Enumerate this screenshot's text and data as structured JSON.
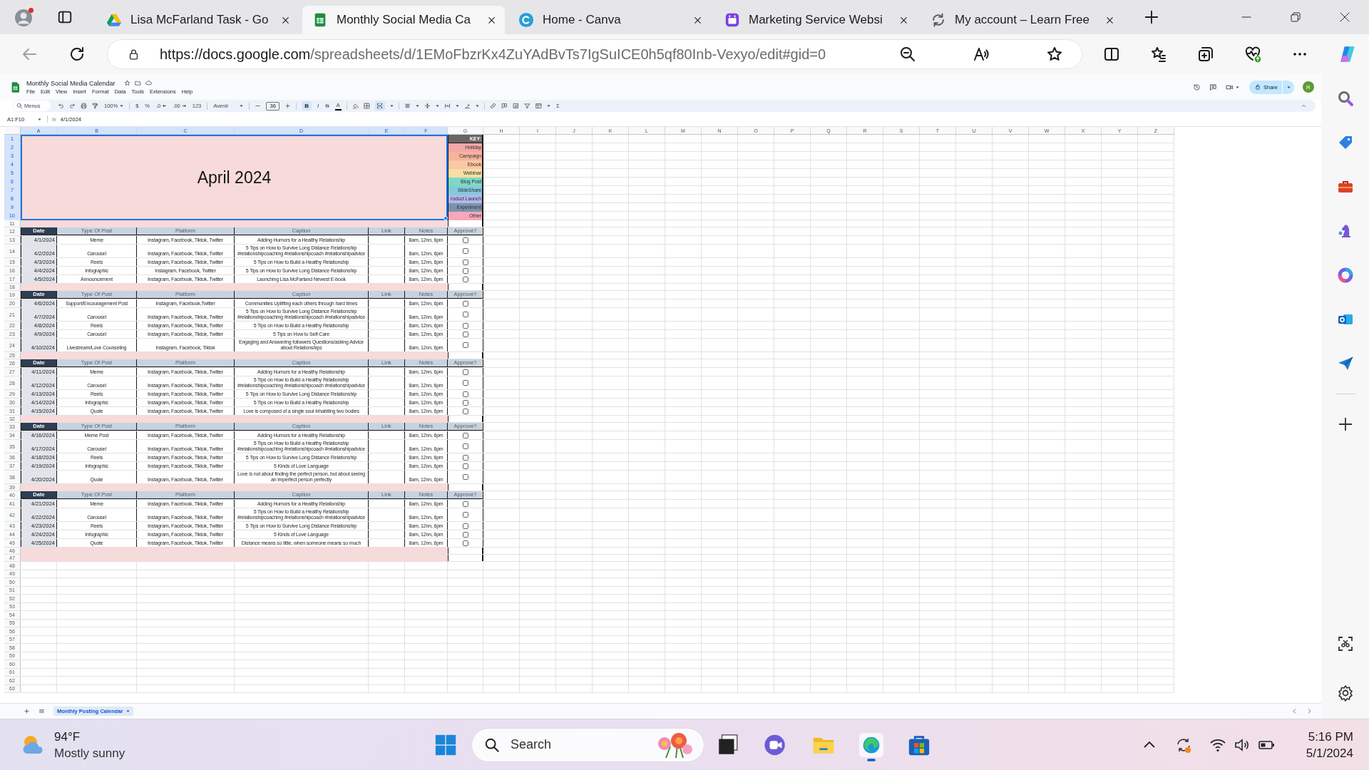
{
  "browser": {
    "tabs": [
      {
        "title": "Lisa McFarland Task - Go",
        "kind": "drive",
        "selected": false
      },
      {
        "title": "Monthly Social Media Ca",
        "kind": "sheets",
        "selected": true
      },
      {
        "title": "Home - Canva",
        "kind": "canva",
        "selected": false
      },
      {
        "title": "Marketing Service Websi",
        "kind": "calendar",
        "selected": false
      },
      {
        "title": "My account – Learn Free",
        "kind": "loading",
        "selected": false
      }
    ],
    "url": {
      "origin": "https://docs.google.com",
      "path": "/spreadsheets/d/1EMoFbzrKx4ZuYAdBvTs7IgSuICE0h5qf80Inb-Vexyo/edit#gid=0"
    }
  },
  "sheets_app": {
    "doc_title": "Monthly Social Media Calendar",
    "menu": [
      "File",
      "Edit",
      "View",
      "Insert",
      "Format",
      "Data",
      "Tools",
      "Extensions",
      "Help"
    ],
    "toolbar": {
      "menus_search": {
        "placeholder": "Menus"
      },
      "zoom": "100%",
      "currency": "$",
      "percent": "%",
      "decimal_decrease": ".0",
      "decimal_increase": ".00",
      "number_format": "123",
      "font": "Avenir",
      "font_size": "36",
      "bold": {
        "label": "B",
        "on": true
      },
      "italic": {
        "label": "I",
        "on": false
      },
      "strikethrough": {
        "label": "S",
        "on": false
      },
      "text_color": "A",
      "merge_on": true,
      "functions": "Σ"
    },
    "share": "Share",
    "account_initial": "R",
    "name_box": "A1:F10",
    "formula_label": "fx",
    "formula": "4/1/2024"
  },
  "sheet": {
    "columns": [
      {
        "label": "A",
        "selected": true
      },
      {
        "label": "B",
        "selected": true
      },
      {
        "label": "C",
        "selected": true
      },
      {
        "label": "D",
        "selected": true
      },
      {
        "label": "E",
        "selected": true
      },
      {
        "label": "F",
        "selected": true
      },
      {
        "label": "G",
        "selected": false
      },
      {
        "label": "H",
        "selected": false
      },
      {
        "label": "I",
        "selected": false
      },
      {
        "label": "J",
        "selected": false
      },
      {
        "label": "K",
        "selected": false
      },
      {
        "label": "L",
        "selected": false
      },
      {
        "label": "M",
        "selected": false
      },
      {
        "label": "N",
        "selected": false
      },
      {
        "label": "O",
        "selected": false
      },
      {
        "label": "P",
        "selected": false
      },
      {
        "label": "Q",
        "selected": false
      },
      {
        "label": "R",
        "selected": false
      },
      {
        "label": "S",
        "selected": false
      },
      {
        "label": "T",
        "selected": false
      },
      {
        "label": "U",
        "selected": false
      },
      {
        "label": "V",
        "selected": false
      },
      {
        "label": "W",
        "selected": false
      },
      {
        "label": "X",
        "selected": false
      },
      {
        "label": "Y",
        "selected": false
      },
      {
        "label": "Z",
        "selected": false
      }
    ],
    "row_numbers": [
      {
        "label": "1",
        "selected": true
      },
      {
        "label": "2",
        "selected": true
      },
      {
        "label": "3",
        "selected": true
      },
      {
        "label": "4",
        "selected": true
      },
      {
        "label": "5",
        "selected": true
      },
      {
        "label": "6",
        "selected": true
      },
      {
        "label": "7",
        "selected": true
      },
      {
        "label": "8",
        "selected": true
      },
      {
        "label": "9",
        "selected": true
      },
      {
        "label": "10",
        "selected": true
      },
      {
        "label": "11",
        "selected": false
      },
      {
        "label": "12",
        "selected": false
      },
      {
        "label": "13",
        "selected": false
      },
      {
        "label": "14",
        "selected": false
      },
      {
        "label": "15",
        "selected": false
      },
      {
        "label": "16",
        "selected": false
      },
      {
        "label": "17",
        "selected": false
      },
      {
        "label": "18",
        "selected": false
      },
      {
        "label": "19",
        "selected": false
      },
      {
        "label": "20",
        "selected": false
      },
      {
        "label": "21",
        "selected": false
      },
      {
        "label": "22",
        "selected": false
      },
      {
        "label": "23",
        "selected": false
      },
      {
        "label": "24",
        "selected": false
      },
      {
        "label": "25",
        "selected": false
      },
      {
        "label": "26",
        "selected": false
      },
      {
        "label": "27",
        "selected": false
      },
      {
        "label": "28",
        "selected": false
      },
      {
        "label": "29",
        "selected": false
      },
      {
        "label": "30",
        "selected": false
      },
      {
        "label": "31",
        "selected": false
      },
      {
        "label": "32",
        "selected": false
      },
      {
        "label": "33",
        "selected": false
      },
      {
        "label": "34",
        "selected": false
      },
      {
        "label": "35",
        "selected": false
      },
      {
        "label": "36",
        "selected": false
      },
      {
        "label": "37",
        "selected": false
      },
      {
        "label": "38",
        "selected": false
      },
      {
        "label": "39",
        "selected": false
      },
      {
        "label": "40",
        "selected": false
      },
      {
        "label": "41",
        "selected": false
      },
      {
        "label": "42",
        "selected": false
      },
      {
        "label": "43",
        "selected": false
      },
      {
        "label": "44",
        "selected": false
      },
      {
        "label": "45",
        "selected": false
      },
      {
        "label": "46",
        "selected": false
      },
      {
        "label": "47",
        "selected": false
      },
      {
        "label": "48",
        "selected": false
      },
      {
        "label": "49",
        "selected": false
      },
      {
        "label": "50",
        "selected": false
      },
      {
        "label": "51",
        "selected": false
      },
      {
        "label": "52",
        "selected": false
      },
      {
        "label": "53",
        "selected": false
      },
      {
        "label": "54",
        "selected": false
      },
      {
        "label": "55",
        "selected": false
      },
      {
        "label": "56",
        "selected": false
      },
      {
        "label": "57",
        "selected": false
      },
      {
        "label": "58",
        "selected": false
      },
      {
        "label": "59",
        "selected": false
      },
      {
        "label": "60",
        "selected": false
      },
      {
        "label": "61",
        "selected": false
      },
      {
        "label": "62",
        "selected": false
      },
      {
        "label": "63",
        "selected": false
      }
    ],
    "title": {
      "text": "April 2024",
      "selected": true
    },
    "key": {
      "header": "KEY:",
      "items": [
        {
          "label": "Holiday",
          "color": "#f4a7a7"
        },
        {
          "label": "Campaign",
          "color": "#f8b49b"
        },
        {
          "label": "Ebook",
          "color": "#fcc7a3"
        },
        {
          "label": "Webinar",
          "color": "#f7dfa6"
        },
        {
          "label": "Blog Post",
          "color": "#7dd9c6"
        },
        {
          "label": "SlideShare",
          "color": "#7fcbdc"
        },
        {
          "label": "roduct Launch",
          "color": "#b2b7ec"
        },
        {
          "label": "Experiment",
          "color": "#7c93ad"
        },
        {
          "label": "Other",
          "color": "#f5a8bb"
        }
      ]
    },
    "weeks": [
      {
        "headers": [
          "Date",
          "Type Of Post",
          "Platform",
          "Caption",
          "Link",
          "Notes",
          "Approve?"
        ],
        "posts": [
          {
            "date": "4/1/2024",
            "type": "Meme",
            "platform": "Instagram, Facebook, Tiktok, Twitter",
            "caption": "Adding Humors for a Healthy Relationship",
            "notes": "8am, 12nn, 6pm",
            "approved": false
          },
          {
            "date": "4/2/2024",
            "type": "Carousel",
            "platform": "Instagram, Facebook, Tiktok, Twitter",
            "caption": "5 Tips on How to Survive Long Distance Relationship #relationshipcoaching #relationshipcoach #relationshipadvice",
            "notes": "8am, 12nn, 6pm",
            "approved": false
          },
          {
            "date": "4/3/2024",
            "type": "Reels",
            "platform": "Instagram, Facebook, Tiktok, Twitter",
            "caption": "5 Tips on How to Build a Healthy Relationship",
            "notes": "8am, 12nn, 6pm",
            "approved": false
          },
          {
            "date": "4/4/2024",
            "type": "Infographic",
            "platform": "Instagram, Facebook, Twitter",
            "caption": "5 Tips on How to Survive Long Distance Relationship",
            "notes": "8am, 12nn, 6pm",
            "approved": false
          },
          {
            "date": "4/5/2024",
            "type": "Announcement",
            "platform": "Instagram, Facebook, Tiktok, Twitter",
            "caption": "Launching Lisa McFarland Newest E-book",
            "notes": "8am, 12nn, 6pm",
            "approved": false
          }
        ]
      },
      {
        "headers": [
          "Date",
          "Type Of Post",
          "Platform",
          "Caption",
          "Link",
          "Notes",
          "Approve?"
        ],
        "posts": [
          {
            "date": "4/6/2024",
            "type": "Support/Encouragement Post",
            "platform": "Instagram, Facebook,Twitter",
            "caption": "Communities Uplifting each others through hard times",
            "notes": "8am, 12nn, 6pm",
            "approved": false
          },
          {
            "date": "4/7/2024",
            "type": "Carousel",
            "platform": "Instagram, Facebook, Tiktok, Twitter",
            "caption": "5 Tips on How to Survive Long Distance Relationship #relationshipcoaching #relationshipcoach #relationshipadvice",
            "notes": "8am, 12nn, 6pm",
            "approved": false
          },
          {
            "date": "4/8/2024",
            "type": "Reels",
            "platform": "Instagram, Facebook, Tiktok, Twitter",
            "caption": "5 Tips on How to Build a Healthy Relationship",
            "notes": "8am, 12nn, 6pm",
            "approved": false
          },
          {
            "date": "4/9/2024",
            "type": "Carousel",
            "platform": "Instagram, Facebook, Tiktok, Twitter",
            "caption": "5 Tips on How to Self-Care",
            "notes": "8am, 12nn, 6pm",
            "approved": false
          },
          {
            "date": "4/10/2024",
            "type": "Livestream/Love Counseling",
            "platform": "Instagram, Facebook, Tiktok",
            "caption": "Engaging and Answering followers Questions/asking Advice about Relationships",
            "notes": "8am, 12nn, 6pm",
            "approved": false
          }
        ]
      },
      {
        "headers": [
          "Date",
          "Type Of Post",
          "Platform",
          "Caption",
          "Link",
          "Notes",
          "Approve?"
        ],
        "posts": [
          {
            "date": "4/11/2024",
            "type": "Meme",
            "platform": "Instagram, Facebook, Tiktok, Twitter",
            "caption": "Adding Humors for a Healthy Relationship",
            "notes": "8am, 12nn, 6pm",
            "approved": false
          },
          {
            "date": "4/12/2024",
            "type": "Carousel",
            "platform": "Instagram, Facebook, Tiktok, Twitter",
            "caption": "5 Tips on How to Build a Healthy Relationship #relationshipcoaching #relationshipcoach #relationshipadvice",
            "notes": "8am, 12nn, 6pm",
            "approved": false
          },
          {
            "date": "4/13/2024",
            "type": "Reels",
            "platform": "Instagram, Facebook, Tiktok, Twitter",
            "caption": "5 Tips on How to Survive Long Distance Relationship",
            "notes": "8am, 12nn, 6pm",
            "approved": false
          },
          {
            "date": "4/14/2024",
            "type": "Infographic",
            "platform": "Instagram, Facebook, Tiktok, Twitter",
            "caption": "5 Tips on How to Build a Healthy Relationship",
            "notes": "8am, 12nn, 6pm",
            "approved": false
          },
          {
            "date": "4/15/2024",
            "type": "Quote",
            "platform": "Instagram, Facebook, Tiktok, Twitter",
            "caption": "Love is composed of a single soul inhabiting two bodies",
            "notes": "8am, 12nn, 6pm",
            "approved": false
          }
        ]
      },
      {
        "headers": [
          "Date",
          "Type Of Post",
          "Platform",
          "Caption",
          "Link",
          "Notes",
          "Approve?"
        ],
        "posts": [
          {
            "date": "4/16/2024",
            "type": "Meme Post",
            "platform": "Instagram, Facebook, Tiktok, Twitter",
            "caption": "Adding Humors for a Healthy Relationship",
            "notes": "8am, 12nn, 6pm",
            "approved": false
          },
          {
            "date": "4/17/2024",
            "type": "Carousel",
            "platform": "Instagram, Facebook, Tiktok, Twitter",
            "caption": "5 Tips on How to Build a Healthy Relationship #relationshipcoaching #relationshipcoach #relationshipadvice",
            "notes": "8am, 12nn, 6pm",
            "approved": false
          },
          {
            "date": "4/18/2024",
            "type": "Reels",
            "platform": "Instagram, Facebook, Tiktok, Twitter",
            "caption": "5 Tips on How to Survive Long Distance Relationship",
            "notes": "8am, 12nn, 6pm",
            "approved": false
          },
          {
            "date": "4/19/2024",
            "type": "Infographic",
            "platform": "Instagram, Facebook, Tiktok, Twitter",
            "caption": "5 Kinds of Love Language",
            "notes": "8am, 12nn, 6pm",
            "approved": false
          },
          {
            "date": "4/20/2024",
            "type": "Quote",
            "platform": "Instagram, Facebook, Tiktok, Twitter",
            "caption": "Love is not about finding the perfect person, but about seeing an imperfect person perfectly",
            "notes": "8am, 12nn, 6pm",
            "approved": false
          }
        ]
      },
      {
        "headers": [
          "Date",
          "Type Of Post",
          "Platform",
          "Caption",
          "Link",
          "Notes",
          "Approve?"
        ],
        "posts": [
          {
            "date": "4/21/2024",
            "type": "Meme",
            "platform": "Instagram, Facebook, Tiktok, Twitter",
            "caption": "Adding Humors for a Healthy Relationship",
            "notes": "8am, 12nn, 6pm",
            "approved": false
          },
          {
            "date": "4/22/2024",
            "type": "Carousel",
            "platform": "Instagram, Facebook, Tiktok, Twitter",
            "caption": "5 Tips on How to Build a Healthy Relationship #relationshipcoaching #relationshipcoach #relationshipadvice",
            "notes": "8am, 12nn, 6pm",
            "approved": false
          },
          {
            "date": "4/23/2024",
            "type": "Reels",
            "platform": "Instagram, Facebook, Tiktok, Twitter",
            "caption": "5 Tips on How to Survive Long Distance Relationship",
            "notes": "8am, 12nn, 6pm",
            "approved": false
          },
          {
            "date": "4/24/2024",
            "type": "Infographic",
            "platform": "Instagram, Facebook, Tiktok, Twitter",
            "caption": "5 Kinds of Love Language",
            "notes": "8am, 12nn, 6pm",
            "approved": false
          },
          {
            "date": "4/25/2024",
            "type": "Quote",
            "platform": "Instagram, Facebook, Tiktok, Twitter",
            "caption": "Distance means so little, when someone means so much",
            "notes": "8am, 12nn, 6pm",
            "approved": false
          }
        ]
      }
    ]
  },
  "sheet_tabs": [
    {
      "label": "Monthly Posting Calendar",
      "selected": true
    }
  ],
  "taskbar": {
    "temperature": "94°F",
    "condition": "Mostly sunny",
    "search": {
      "placeholder": "Search"
    },
    "time": "5:16 PM",
    "date": "5/1/2024"
  }
}
